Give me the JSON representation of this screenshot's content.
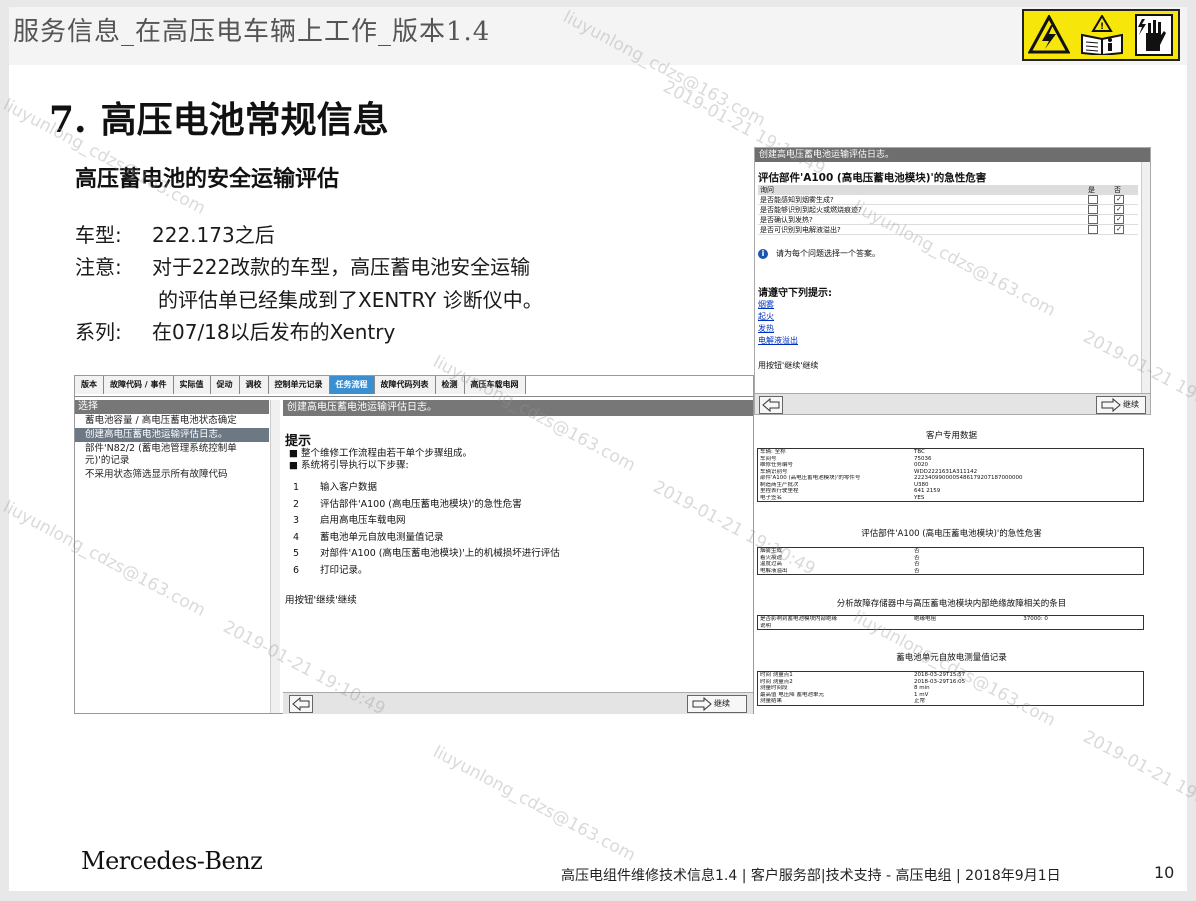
{
  "header": {
    "title": "服务信息_在高压电车辆上工作_版本1.4"
  },
  "section": {
    "number": "7.",
    "title": "高压电池常规信息",
    "subheading": "高压蓄电池的安全运输评估"
  },
  "info": {
    "model_label": "车型:",
    "model_value": "222.173之后",
    "note_label": "注意:",
    "note_line1": "对于222改款的车型，高压蓄电池安全运输",
    "note_line2": "的评估单已经集成到了XENTRY 诊断仪中。",
    "series_label": "系列:",
    "series_value": "在07/18以后发布的Xentry"
  },
  "left_screen": {
    "tabs": [
      "版本",
      "故障代码 / 事件",
      "实际值",
      "促动",
      "调校",
      "控制单元记录",
      "任务流程",
      "故障代码列表",
      "检测",
      "高压车载电网"
    ],
    "active_tab": 6,
    "side_header": "选择",
    "side_items": [
      "蓄电池容量 / 高电压蓄电池状态确定",
      "创建高电压蓄电池运输评估日志。",
      "部件'N82/2 (蓄电池管理系统控制单元)'的记录",
      "不采用状态筛选显示所有故障代码"
    ],
    "selected_item": 1,
    "main_header": "创建高电压蓄电池运输评估日志。",
    "hint_title": "提示",
    "hint_lines": [
      "整个维修工作流程由若干单个步骤组成。",
      "系统将引导执行以下步骤:"
    ],
    "steps": [
      {
        "n": "1",
        "text": "输入客户数据"
      },
      {
        "n": "2",
        "text": "评估部件'A100 (高电压蓄电池模块)'的急性危害"
      },
      {
        "n": "3",
        "text": "启用高电压车载电网"
      },
      {
        "n": "4",
        "text": "蓄电池单元自放电测量值记录"
      },
      {
        "n": "5",
        "text": "对部件'A100 (高电压蓄电池模块)'上的机械损坏进行评估"
      },
      {
        "n": "6",
        "text": "打印记录。"
      }
    ],
    "continue_note": "用按钮'继续'继续",
    "next_label": "继续"
  },
  "right_top_screen": {
    "header": "创建高电压蓄电池运输评估日志。",
    "title": "评估部件'A100 (高电压蓄电池模块)'的急性危害",
    "table_headers": [
      "询问",
      "是",
      "否"
    ],
    "questions": [
      "是否能感知到烟雾生成?",
      "是否能够识别到起火或燃烧痕迹?",
      "是否确认到发热?",
      "是否可识别到电解液溢出?"
    ],
    "info_text": "请为每个问题选择一个答案。",
    "tips_title": "请遵守下列提示:",
    "tips_links": [
      "烟雾",
      "起火",
      "发热",
      "电解液溢出"
    ],
    "continue_note": "用按钮'继续'继续",
    "next_label": "继续"
  },
  "report": {
    "customer_title": "客户专用数据",
    "customer_rows": [
      [
        "车辆: 全称",
        "TBC"
      ],
      [
        "车间号",
        "75036"
      ],
      [
        "维修任务编号",
        "0020"
      ],
      [
        "车辆识别号",
        "WDD2221631A311142"
      ],
      [
        "部件'A100 (高电压蓄电池模块)'的零件号",
        "2223409900005486179207187000000"
      ],
      [
        "制造商生产批次",
        "U380"
      ],
      [
        "里程表行驶里程",
        "641 2159"
      ],
      [
        "电子签名",
        "YES"
      ]
    ],
    "hazard_title": "评估部件'A100 (高电压蓄电池模块)'的急性危害",
    "hazard_rows": [
      [
        "烟雾生成",
        "否"
      ],
      [
        "着火痕迹",
        "否"
      ],
      [
        "温度过高",
        "否"
      ],
      [
        "电解液溢出",
        "否"
      ]
    ],
    "fault_title": "分析故障存储器中与高压蓄电池模块内部绝缘故障相关的条目",
    "fault_rows": [
      [
        "是否影响到蓄电池模块内部绝缘",
        "绝缘电阻",
        "37000: 0"
      ],
      [
        "说明",
        "",
        ""
      ]
    ],
    "selfdis_title": "蓄电池单元自放电测量值记录",
    "selfdis_rows": [
      [
        "时间 测量点1",
        "2018-03-29T15:57"
      ],
      [
        "时间 测量点2",
        "2018-03-29T16:05"
      ],
      [
        "测量时间段",
        "8 min"
      ],
      [
        "最高值 电压降 蓄电池单元",
        "1 mV"
      ],
      [
        "测量结果",
        "正常"
      ]
    ]
  },
  "footer": {
    "brand": "Mercedes-Benz",
    "text": "高压电组件维修技术信息1.4 | 客户服务部|技术支持 - 高压电组 | 2018年9月1日",
    "page": "10"
  },
  "watermarks": {
    "user": "liuyunlong_cdzs@163.com",
    "stamp": "2019-01-21 19:10:49"
  },
  "colors": {
    "warning_yellow": "#f7e60a",
    "active_tab": "#3a8fd0",
    "header_gray": "#777777"
  }
}
